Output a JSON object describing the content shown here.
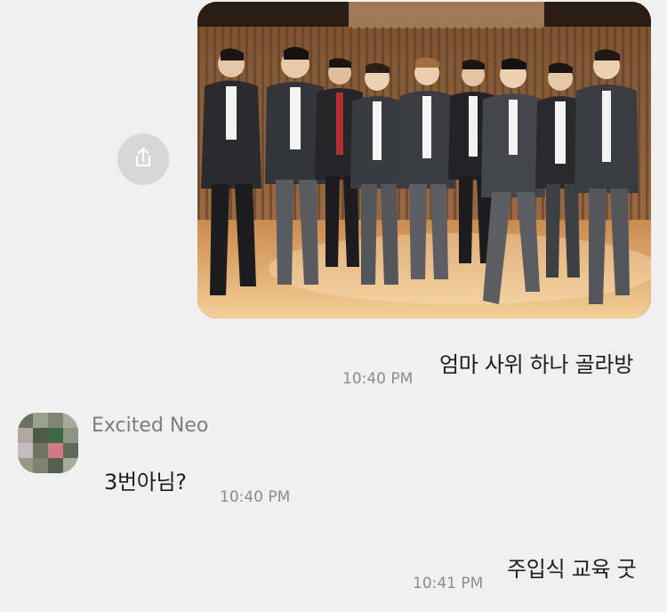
{
  "chat": {
    "messages": [
      {
        "text": "엄마 사위 하나 골라방",
        "time": "10:40 PM"
      },
      {
        "sender": "Excited Neo",
        "text": "3번아님?",
        "time": "10:40 PM"
      },
      {
        "text": "주입식 교육 굿",
        "time": "10:41 PM"
      }
    ]
  },
  "icons": {
    "share": "share-icon",
    "avatar": "pixelated-avatar"
  }
}
